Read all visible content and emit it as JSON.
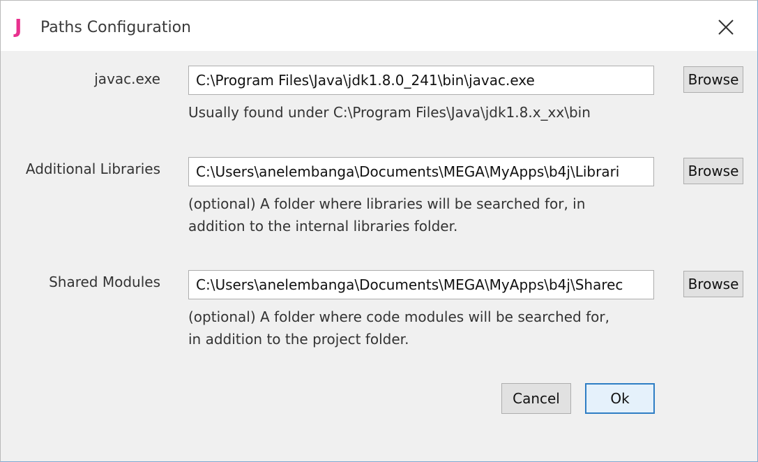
{
  "window": {
    "title": "Paths Configuration",
    "app_icon_glyph": "J",
    "app_icon_color": "#e8318e",
    "close_icon": "close-icon"
  },
  "fields": [
    {
      "label": "javac.exe",
      "value": "C:\\Program Files\\Java\\jdk1.8.0_241\\bin\\javac.exe",
      "browse_label": "Browse",
      "hint": "Usually found under C:\\Program Files\\Java\\jdk1.8.x_xx\\bin"
    },
    {
      "label": "Additional Libraries",
      "value": "C:\\Users\\anelembanga\\Documents\\MEGA\\MyApps\\b4j\\Librari",
      "browse_label": "Browse",
      "hint": "(optional) A folder where libraries will be searched for, in\naddition to the internal libraries folder."
    },
    {
      "label": "Shared Modules",
      "value": "C:\\Users\\anelembanga\\Documents\\MEGA\\MyApps\\b4j\\Sharec",
      "browse_label": "Browse",
      "hint": "(optional) A folder where code modules will be searched for,\nin addition to the project folder."
    }
  ],
  "buttons": {
    "cancel_label": "Cancel",
    "ok_label": "Ok"
  },
  "colors": {
    "accent": "#2e7dc4",
    "button_face": "#e1e1e1"
  }
}
